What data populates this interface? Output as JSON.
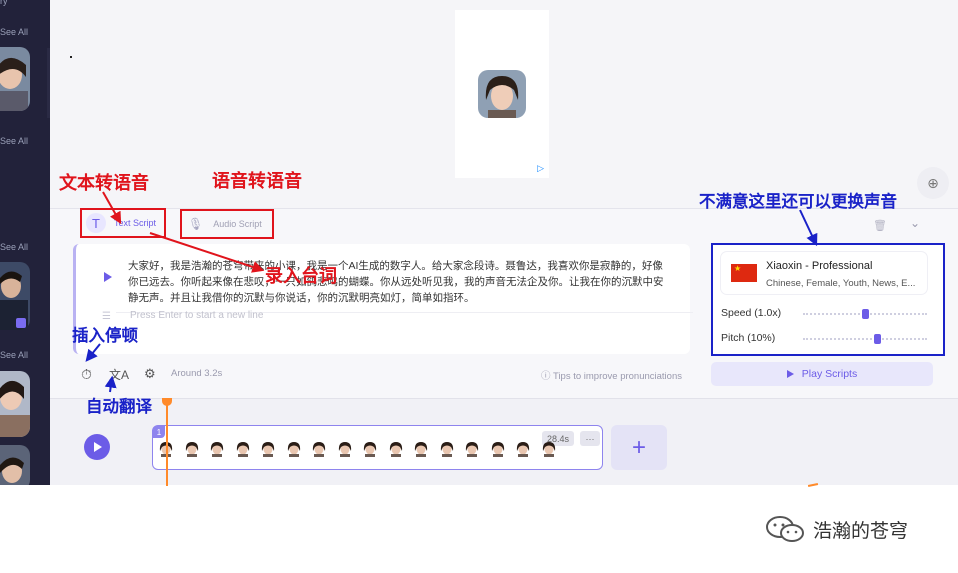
{
  "sidebar": {
    "partial_label": "ry",
    "see_all_label": "See All",
    "collapse_icon": "chevron-left-icon"
  },
  "preview": {
    "avatar_icon": "avatar-thumbnail",
    "badge_icon": "ad-choices-icon"
  },
  "editor": {
    "tabs": [
      {
        "label": "Text Script",
        "icon": "text-icon",
        "active": true
      },
      {
        "label": "Audio Script",
        "icon": "microphone-icon",
        "active": false
      }
    ],
    "script_text": "大家好，我是浩瀚的苍穹带来的小课，我是一个AI生成的数字人。给大家念段诗。聂鲁达，我喜欢你是寂静的，好像你已远去。你听起来像在悲叹，一只如鸽悲鸣的蝴蝶。你从远处听见我，我的声音无法企及你。让我在你的沉默中安静无声。并且让我借你的沉默与你说话，你的沉默明亮如灯，简单如指环。",
    "new_line_placeholder": "Press Enter to start a new line",
    "duration_estimate": "Around 3.2s",
    "tips_label": "Tips to improve pronunciations"
  },
  "voice": {
    "name": "Xiaoxin - Professional",
    "tags": "Chinese, Female, Youth, News, E...",
    "flag": "china-flag",
    "speed_label": "Speed (1.0x)",
    "speed_fraction": 0.5,
    "pitch_label": "Pitch (10%)",
    "pitch_fraction": 0.6,
    "play_label": "Play Scripts"
  },
  "timeline": {
    "clip_number": "1",
    "clip_duration": "28.4s",
    "more_label": "···",
    "add_label": "+"
  },
  "annotations": {
    "text_to_speech": "文本转语音",
    "speech_to_speech": "语音转语音",
    "enter_lines": "录入台词",
    "change_voice": "不满意这里还可以更换声音",
    "insert_pause": "插入停顿",
    "auto_translate": "自动翻译"
  },
  "watermark": {
    "text": "浩瀚的苍穹",
    "icon": "wechat-icon"
  },
  "colors": {
    "accent": "#6c5ce7",
    "annotation_red": "#e0141c",
    "annotation_blue": "#1a22c8",
    "sidebar": "#22223a",
    "playhead": "#ff8a2a"
  }
}
